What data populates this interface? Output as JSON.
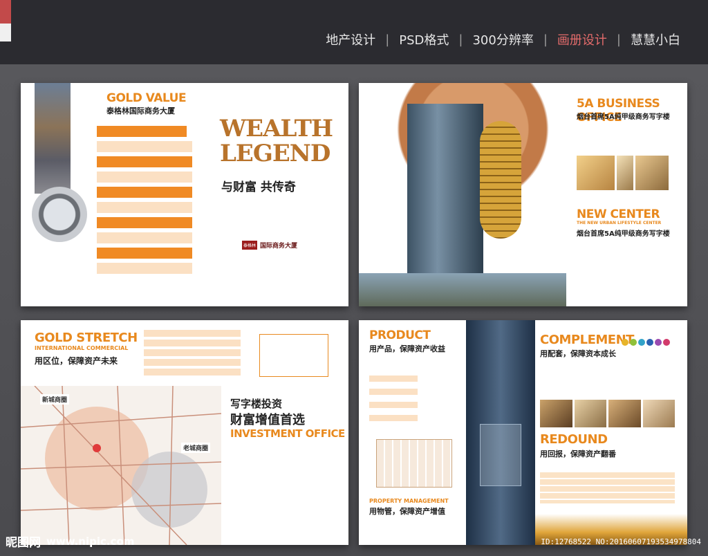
{
  "nav": {
    "items": [
      "地产设计",
      "PSD格式",
      "300分辨率",
      "画册设计",
      "慧慧小白"
    ],
    "separator": "|",
    "active": "画册设计"
  },
  "p1": {
    "heading_en": "GOLD VALUE",
    "heading_cn": "泰格林国际商务大厦",
    "brand": "泰格林",
    "brand_suffix": "国际商务大厦",
    "wealth_1": "WEALTH",
    "wealth_2": "LEGEND",
    "slogan": "与财富 共传奇"
  },
  "p2": {
    "h1_en": "5A BUSINESS OFFICE",
    "h1_cn": "烟台首席5A纯甲级商务写字楼",
    "h2_en": "NEW CENTER",
    "h2_sub": "THE NEW URBAN LIFESTYLE CENTER",
    "h2_cn": "烟台首席5A纯甲级商务写字楼"
  },
  "p3": {
    "h_en": "GOLD STRETCH",
    "h_en2": "INTERNATIONAL COMMERCIAL",
    "h_cn": "用区位，保障资产未来",
    "map_new": "新城商圈",
    "map_old": "老城商圈",
    "office_cn1": "写字楼投资",
    "office_cn2": "财富增值首选",
    "office_en": "INVESTMENT OFFICE"
  },
  "p4": {
    "product_en": "PRODUCT",
    "product_cn": "用产品，保障资产收益",
    "pm_en": "PROPERTY MANAGEMENT",
    "pm_cn": "用物管，保障资产增值",
    "comp_en": "COMPLEMENT",
    "comp_cn": "用配套，保障资本成长",
    "red_en": "REDOUND",
    "red_cn": "用回报，保障资产翻番"
  },
  "footer": {
    "logo": "昵图网",
    "url": "www.nipic.com",
    "id": "ID:12768522 NO:20160607193534978804"
  },
  "colors": {
    "accent": "#e8891e",
    "active_nav": "#e36b6b"
  }
}
